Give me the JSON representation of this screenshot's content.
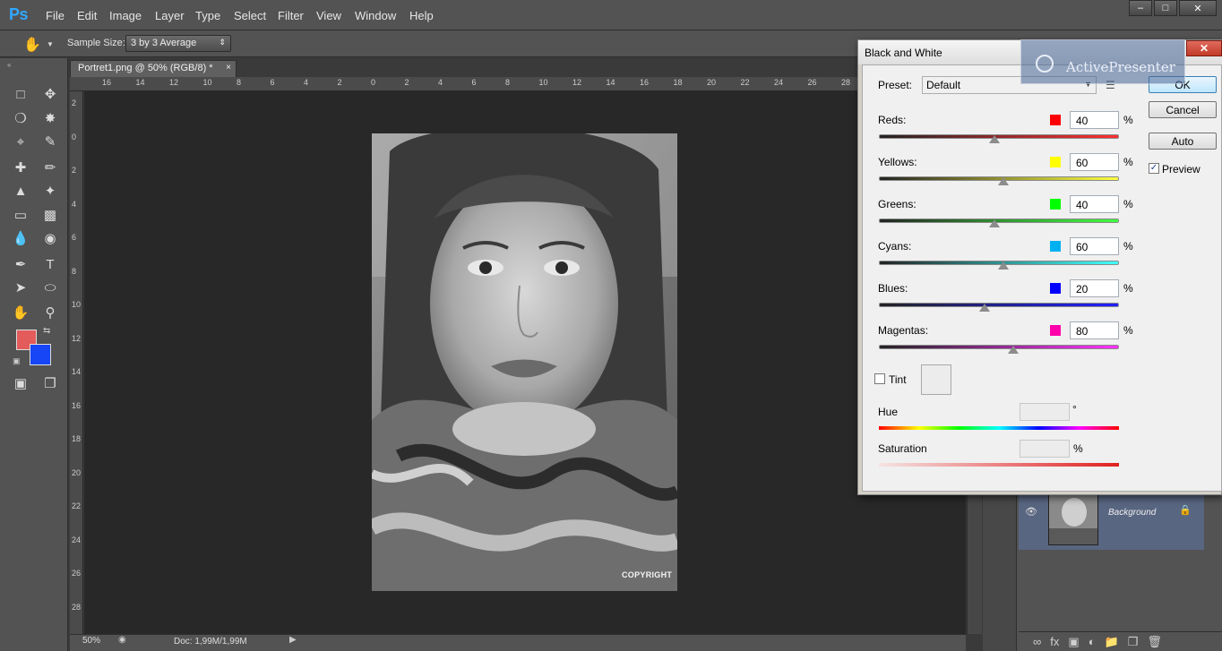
{
  "app": {
    "logo": "Ps"
  },
  "menu": [
    "File",
    "Edit",
    "Image",
    "Layer",
    "Type",
    "Select",
    "Filter",
    "View",
    "Window",
    "Help"
  ],
  "window_controls": {
    "minimize": "‒",
    "maximize": "□",
    "close": "✕"
  },
  "options_bar": {
    "sample_size_label": "Sample Size:",
    "sample_size_value": "3 by 3 Average"
  },
  "document": {
    "tab_title": "Portret1.png @ 50% (RGB/8) *",
    "tab_close": "×",
    "copyright_mark": "COPYRIGHT"
  },
  "ruler_top_labels": [
    "16",
    "14",
    "12",
    "10",
    "8",
    "6",
    "4",
    "2",
    "0",
    "2",
    "4",
    "6",
    "8",
    "10",
    "12",
    "14",
    "16",
    "18",
    "20",
    "22",
    "24",
    "26",
    "28"
  ],
  "ruler_left_labels": [
    "2",
    "0",
    "2",
    "4",
    "6",
    "8",
    "10",
    "12",
    "14",
    "16",
    "18",
    "20",
    "22",
    "24",
    "26",
    "28"
  ],
  "status": {
    "zoom": "50%",
    "doc_info": "Doc: 1,99M/1,99M"
  },
  "layers": {
    "layer_name": "Background"
  },
  "dialog": {
    "title": "Black and White",
    "close_glyph": "✕",
    "preset_label": "Preset:",
    "preset_value": "Default",
    "buttons": {
      "ok": "OK",
      "cancel": "Cancel",
      "auto": "Auto"
    },
    "preview_label": "Preview",
    "preview_checked": true,
    "sliders": [
      {
        "label": "Reds:",
        "value": "40",
        "unit": "%",
        "color": "#ff0000",
        "track": [
          "#222222",
          "#ff3030"
        ],
        "level_pct": 48
      },
      {
        "label": "Yellows:",
        "value": "60",
        "unit": "%",
        "color": "#ffff00",
        "track": [
          "#222222",
          "#ffff40"
        ],
        "level_pct": 52
      },
      {
        "label": "Greens:",
        "value": "40",
        "unit": "%",
        "color": "#00ff00",
        "track": [
          "#222222",
          "#40ff40"
        ],
        "level_pct": 48
      },
      {
        "label": "Cyans:",
        "value": "60",
        "unit": "%",
        "color": "#00b0f0",
        "track": [
          "#222222",
          "#40ffff"
        ],
        "level_pct": 52
      },
      {
        "label": "Blues:",
        "value": "20",
        "unit": "%",
        "color": "#0000ff",
        "track": [
          "#222222",
          "#2020ff"
        ],
        "level_pct": 44
      },
      {
        "label": "Magentas:",
        "value": "80",
        "unit": "%",
        "color": "#ff00aa",
        "track": [
          "#222222",
          "#ff30ff"
        ],
        "level_pct": 56
      }
    ],
    "tint_label": "Tint",
    "tint_checked": false,
    "hue_label": "Hue",
    "hue_unit": "°",
    "saturation_label": "Saturation",
    "saturation_unit": "%"
  },
  "watermark": {
    "text": "ActivePresenter"
  }
}
